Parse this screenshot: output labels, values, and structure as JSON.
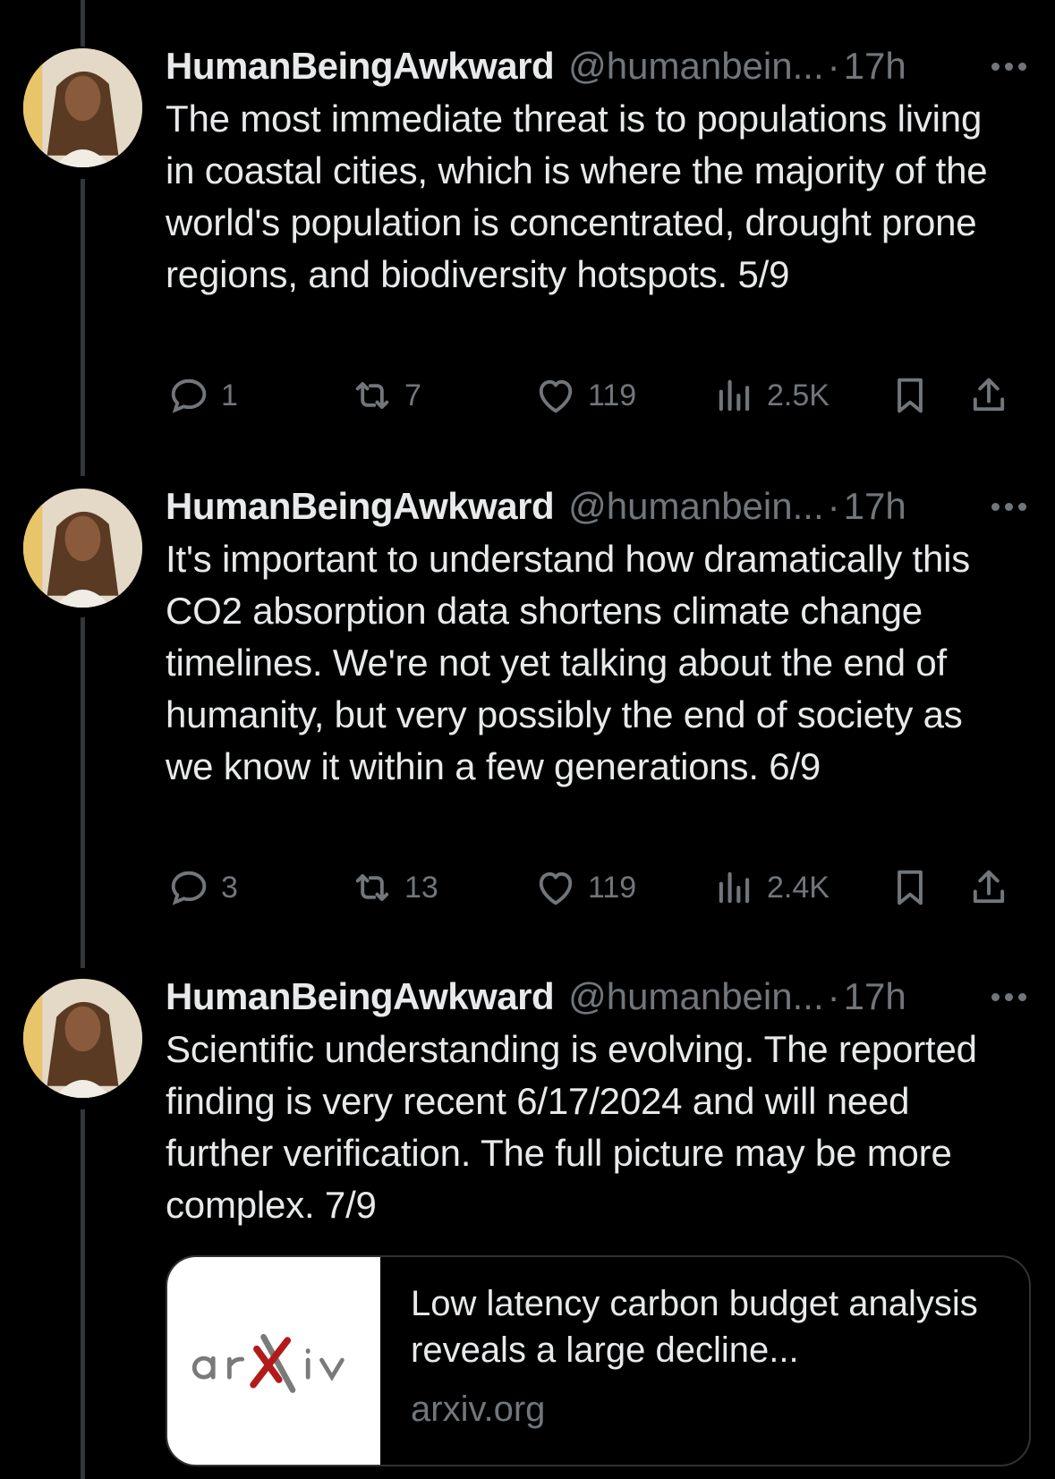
{
  "tweets": [
    {
      "name": "HumanBeingAwkward",
      "handle": "@humanbein...",
      "separator": "·",
      "time": "17h",
      "text": "The most immediate threat is to populations living in coastal cities, which is where the majority of the world's population is concentrated, drought prone regions, and biodiversity hotspots. 5/9",
      "replies": "1",
      "reposts": "7",
      "likes": "119",
      "views": "2.5K"
    },
    {
      "name": "HumanBeingAwkward",
      "handle": "@humanbein...",
      "separator": "·",
      "time": "17h",
      "text": "It's important to understand how dramatically this CO2 absorption data shortens climate change timelines. We're not yet talking about the end of humanity, but very possibly the end of society as we know it within a few generations. 6/9",
      "replies": "3",
      "reposts": "13",
      "likes": "119",
      "views": "2.4K"
    },
    {
      "name": "HumanBeingAwkward",
      "handle": "@humanbein...",
      "separator": "·",
      "time": "17h",
      "text": "Scientific understanding is evolving. The reported finding is very recent 6/17/2024 and will need further verification. The full picture may be more complex. 7/9",
      "card": {
        "logo_text": "arXiv",
        "title": "Low latency carbon budget analysis reveals a large decline...",
        "domain": "arxiv.org"
      }
    }
  ],
  "icons": {
    "reply": "reply-icon",
    "repost": "repost-icon",
    "like": "heart-icon",
    "views": "views-icon",
    "bookmark": "bookmark-icon",
    "share": "share-icon",
    "more": "more-icon"
  },
  "colors": {
    "background": "#000000",
    "text_primary": "#e7e9ea",
    "text_secondary": "#71767b",
    "border": "#2f3336",
    "thread_line": "#333639",
    "arxiv_red": "#b31b1b",
    "arxiv_gray": "#7a7a7a"
  }
}
